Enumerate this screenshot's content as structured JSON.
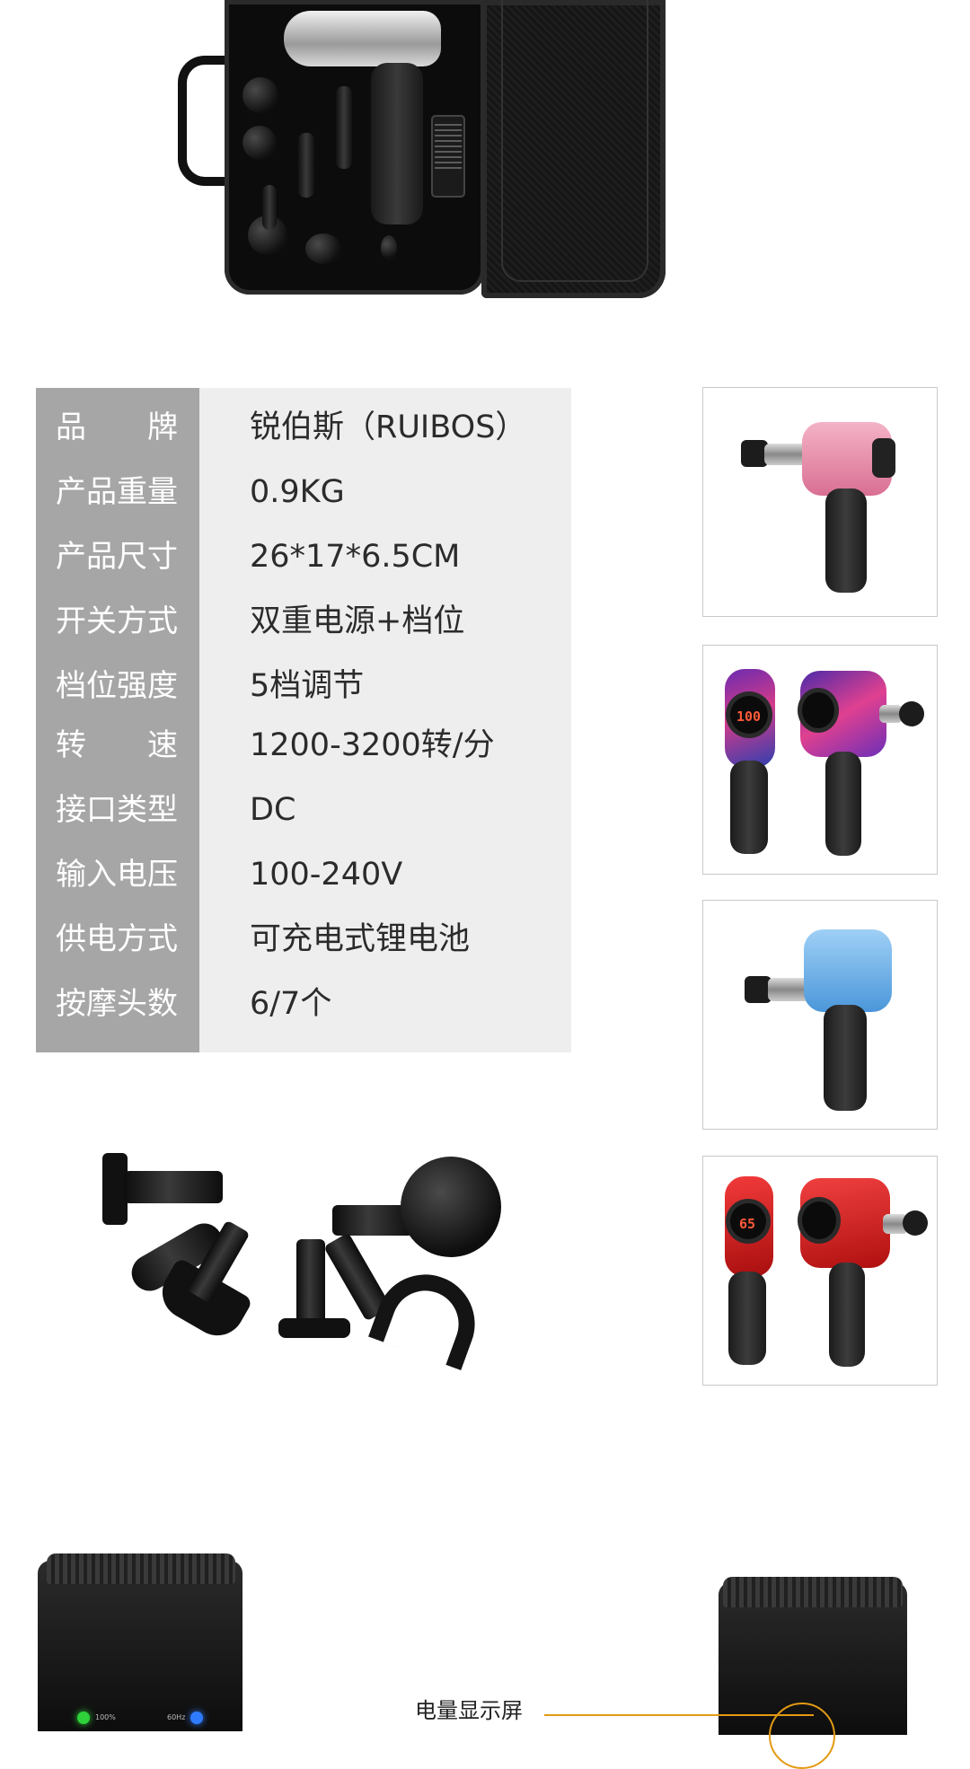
{
  "case_image": {
    "label": "massage gun carry case with accessories"
  },
  "specs": {
    "rows": [
      {
        "label": "品　　牌",
        "value": "锐伯斯（RUIBOS）"
      },
      {
        "label": "产品重量",
        "value": "0.9KG"
      },
      {
        "label": "产品尺寸",
        "value": "26*17*6.5CM"
      },
      {
        "label": "开关方式",
        "value": "双重电源+档位"
      },
      {
        "label": "档位强度",
        "value": "5档调节"
      },
      {
        "label": "转　　速",
        "value": "1200-3200转/分"
      },
      {
        "label": "接口类型",
        "value": "DC"
      },
      {
        "label": "输入电压",
        "value": "100-240V"
      },
      {
        "label": "供电方式",
        "value": "可充电式锂电池"
      },
      {
        "label": "按摩头数",
        "value": "6/7个"
      }
    ]
  },
  "thumbnails": [
    {
      "color": "#e48aa6",
      "variant": "pink"
    },
    {
      "color": "#8a3fb8",
      "variant": "galaxy",
      "digits": "100"
    },
    {
      "color": "#5aa8e6",
      "variant": "blue"
    },
    {
      "color": "#d21b1b",
      "variant": "red",
      "digits": "65"
    }
  ],
  "bottom": {
    "led_labels": [
      "100%",
      "60Hz"
    ],
    "callout": "电量显示屏"
  }
}
